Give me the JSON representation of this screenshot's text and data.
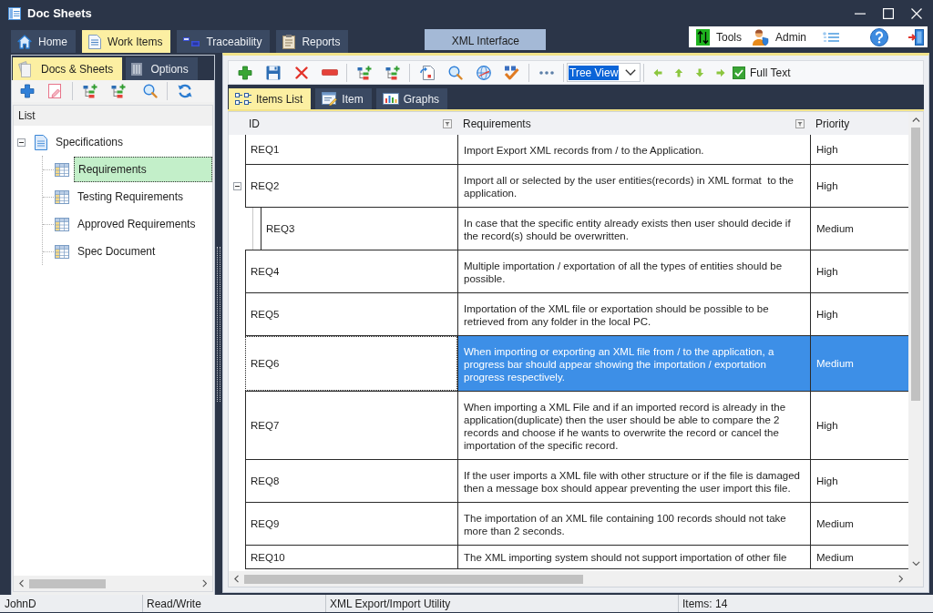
{
  "window": {
    "title": "Doc Sheets"
  },
  "main_tabs": [
    {
      "label": "Home",
      "selected": false
    },
    {
      "label": "Work Items",
      "selected": true
    },
    {
      "label": "Traceability",
      "selected": false
    },
    {
      "label": "Reports",
      "selected": false
    }
  ],
  "context_group": {
    "label": "XML Interface"
  },
  "quick_toolbar": [
    {
      "label": "Tools"
    },
    {
      "label": "Admin"
    }
  ],
  "left_panel": {
    "tabs": [
      {
        "label": "Docs & Sheets",
        "selected": true
      },
      {
        "label": "Options",
        "selected": false
      }
    ],
    "list_header": "List",
    "tree": [
      {
        "label": "Specifications",
        "expanded": true,
        "selected": false,
        "children": [
          {
            "label": "Requirements",
            "selected": true
          },
          {
            "label": "Testing Requirements",
            "selected": false
          },
          {
            "label": "Approved Requirements",
            "selected": false
          },
          {
            "label": "Spec Document",
            "selected": false
          }
        ]
      }
    ]
  },
  "right_panel": {
    "toolbar": {
      "view_select": {
        "value": "Tree View"
      },
      "full_text": {
        "label": "Full Text",
        "checked": true
      }
    },
    "tabs": [
      {
        "label": "Items List",
        "selected": true
      },
      {
        "label": "Item",
        "selected": false
      },
      {
        "label": "Graphs",
        "selected": false
      }
    ],
    "grid": {
      "columns": [
        {
          "label": "ID",
          "filter_button": true
        },
        {
          "label": "Requirements",
          "filter_button": true
        },
        {
          "label": "Priority",
          "filter_button": false
        }
      ],
      "rows": [
        {
          "id": "REQ1",
          "requirement": "Import Export XML records from / to the Application.",
          "priority": "High",
          "selected": false
        },
        {
          "id": "REQ2",
          "requirement": "Import all or selected by the user entities(records) in XML format  to the application.",
          "priority": "High",
          "selected": false,
          "expanded": true,
          "children": [
            {
              "id": "REQ3",
              "requirement": "In case that the specific entity already exists then user should decide if the record(s) should be overwritten.",
              "priority": "Medium",
              "selected": false
            }
          ]
        },
        {
          "id": "REQ4",
          "requirement": "Multiple importation / exportation of all the types of entities should be possible.",
          "priority": "High",
          "selected": false
        },
        {
          "id": "REQ5",
          "requirement": "Importation of the XML file or exportation should be possible to be retrieved from any folder in the local PC.",
          "priority": "High",
          "selected": false
        },
        {
          "id": "REQ6",
          "requirement": "When importing or exporting an XML file from / to the application, a progress bar should appear showing the importation / exportation progress respectively.",
          "priority": "Medium",
          "selected": true
        },
        {
          "id": "REQ7",
          "requirement": "When importing a XML File and if an imported record is already in the application(duplicate) then the user should be able to compare the 2 records and choose if he wants to overwrite the record or cancel the importation of the specific record.",
          "priority": "High",
          "selected": false
        },
        {
          "id": "REQ8",
          "requirement": "If the user imports a XML file with other structure or if the file is damaged then a message box should appear preventing the user import this file.",
          "priority": "High",
          "selected": false
        },
        {
          "id": "REQ9",
          "requirement": "The importation of an XML file containing 100 records should not take more than 2 seconds.",
          "priority": "Medium",
          "selected": false
        },
        {
          "id": "REQ10",
          "requirement": "The XML importing system should not support importation of other file",
          "priority": "Medium",
          "selected": false
        }
      ]
    }
  },
  "status_bar": [
    "JohnD",
    "Read/Write",
    "XML Export/Import Utility",
    "Items: 14"
  ]
}
